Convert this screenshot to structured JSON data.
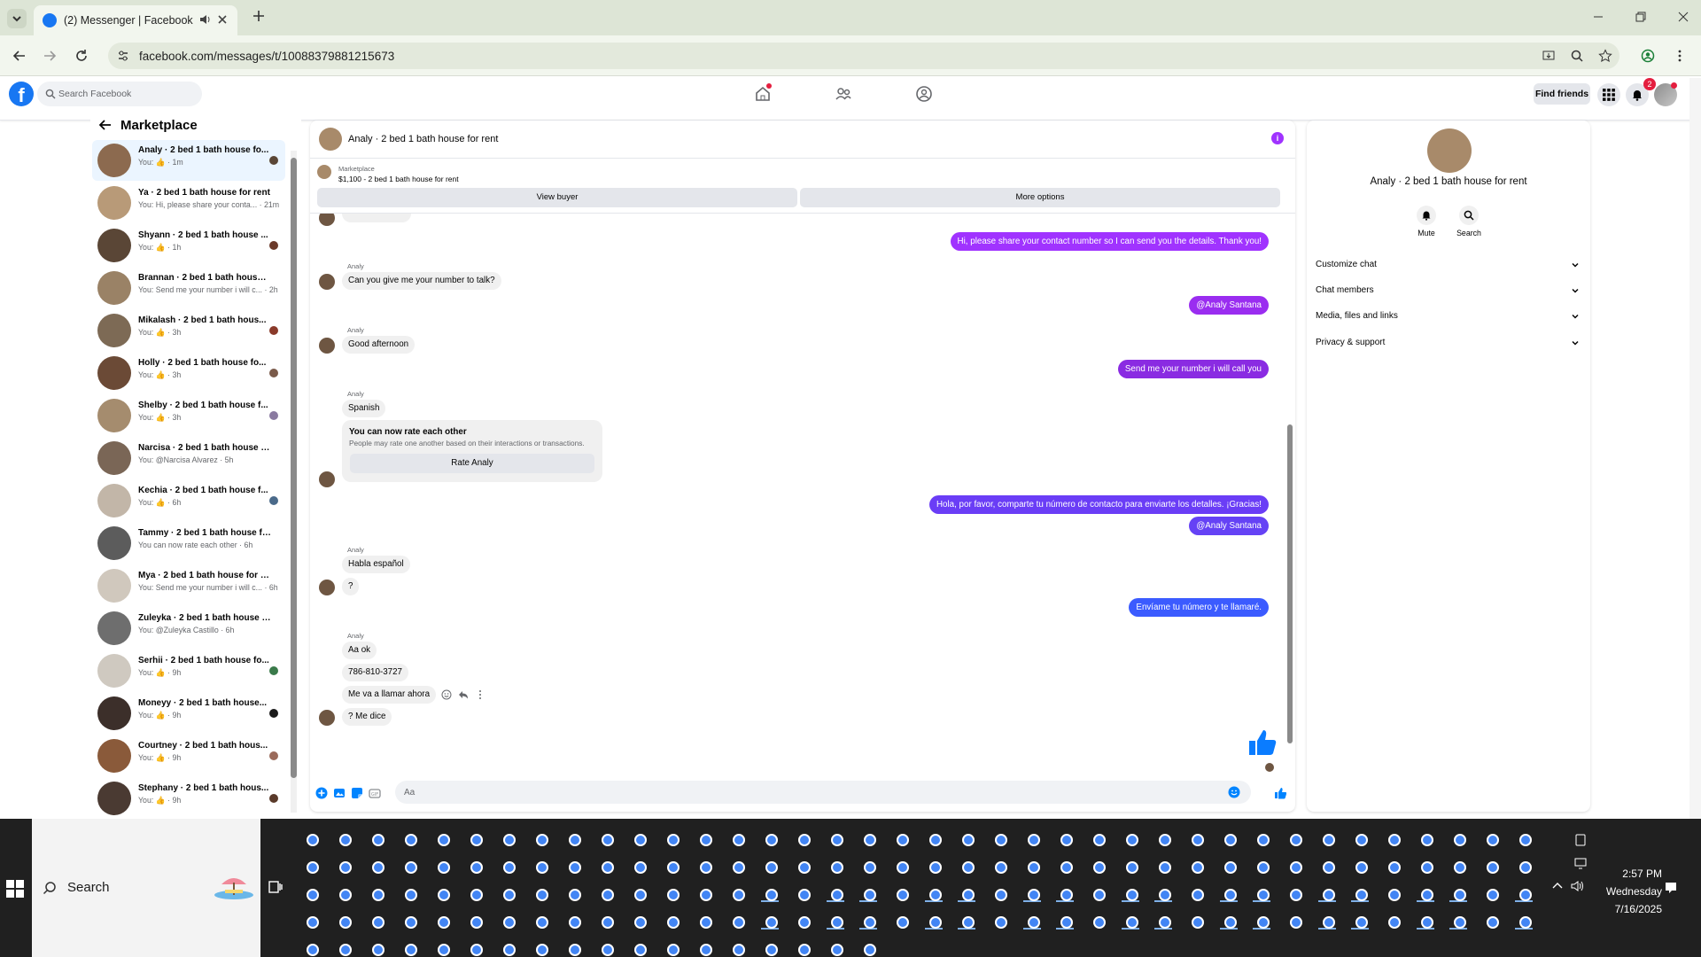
{
  "browser": {
    "tab_title": "(2) Messenger | Facebook",
    "url": "facebook.com/messages/t/10088379881215673"
  },
  "facebook": {
    "search_placeholder": "Search Facebook",
    "find_friends": "Find friends",
    "notification_count": "2"
  },
  "left_panel": {
    "title": "Marketplace",
    "conversations": [
      {
        "name": "Analy · 2 bed 1 bath house fo...",
        "preview": "You: 👍 · 1m",
        "active": true
      },
      {
        "name": "Ya · 2 bed 1 bath house for rent",
        "preview": "You: Hi, please share your conta... · 21m",
        "active": false
      },
      {
        "name": "Shyann · 2 bed 1 bath house ...",
        "preview": "You: 👍 · 1h",
        "active": false
      },
      {
        "name": "Brannan · 2 bed 1 bath house f...",
        "preview": "You: Send me your number i will c... · 2h",
        "active": false
      },
      {
        "name": "Mikalash · 2 bed 1 bath hous...",
        "preview": "You: 👍 · 3h",
        "active": false
      },
      {
        "name": "Holly · 2 bed 1 bath house fo...",
        "preview": "You: 👍 · 3h",
        "active": false
      },
      {
        "name": "Shelby · 2 bed 1 bath house f...",
        "preview": "You: 👍 · 3h",
        "active": false
      },
      {
        "name": "Narcisa · 2 bed 1 bath house fo...",
        "preview": "You: @Narcisa Alvarez · 5h",
        "active": false
      },
      {
        "name": "Kechia · 2 bed 1 bath house f...",
        "preview": "You: 👍 · 6h",
        "active": false
      },
      {
        "name": "Tammy · 2 bed 1 bath house for...",
        "preview": "You can now rate each other · 6h",
        "active": false
      },
      {
        "name": "Mya · 2 bed 1 bath house for rent",
        "preview": "You: Send me your number i will c... · 6h",
        "active": false
      },
      {
        "name": "Zuleyka · 2 bed 1 bath house fo...",
        "preview": "You: @Zuleyka Castillo · 6h",
        "active": false
      },
      {
        "name": "Serhii · 2 bed 1 bath house fo...",
        "preview": "You: 👍 · 9h",
        "active": false
      },
      {
        "name": "Moneyy · 2 bed 1 bath house...",
        "preview": "You: 👍 · 9h",
        "active": false
      },
      {
        "name": "Courtney · 2 bed 1 bath hous...",
        "preview": "You: 👍 · 9h",
        "active": false
      },
      {
        "name": "Stephany · 2 bed 1 bath hous...",
        "preview": "You: 👍 · 9h",
        "active": false
      }
    ]
  },
  "chat": {
    "title": "Analy · 2 bed 1 bath house for rent",
    "marketplace_label": "Marketplace",
    "price_line": "$1,100 - 2 bed 1 bath house for rent",
    "view_buyer": "View buyer",
    "more_options": "More options",
    "sender_name": "Analy",
    "messages": {
      "out1": "Hi, please share your contact number so I can send you the details. Thank you!",
      "in1": "Can you give me your number to talk?",
      "out2": "@Analy Santana",
      "in2": "Good afternoon",
      "out3": "Send me your number i will call you",
      "in3": "Spanish",
      "out4": "Hola, por favor, comparte tu número de contacto para enviarte los detalles. ¡Gracias!",
      "out5": "@Analy Santana",
      "in4": "Habla español",
      "in5": "?",
      "out6": "Envíame tu número y te llamaré.",
      "in6": "Aa ok",
      "in7": "786-810-3727",
      "in8": "Me va a llamar ahora",
      "in9": "? Me dice"
    },
    "rate_card": {
      "title": "You can now rate each other",
      "subtitle": "People may rate one another based on their interactions or transactions.",
      "button": "Rate Analy"
    },
    "composer_placeholder": "Aa",
    "colors": {
      "bubble_purple": "#a033ff",
      "bubble_violet": "#8a2be2",
      "bubble_blue": "#3b5bff",
      "accent": "#0084ff"
    }
  },
  "right_panel": {
    "name": "Analy · 2 bed 1 bath house for rent",
    "mute": "Mute",
    "search": "Search",
    "sections": [
      "Customize chat",
      "Chat members",
      "Media, files and links",
      "Privacy & support"
    ]
  },
  "taskbar": {
    "search": "Search",
    "time": "2:57 PM",
    "day": "Wednesday",
    "date": "7/16/2025"
  }
}
